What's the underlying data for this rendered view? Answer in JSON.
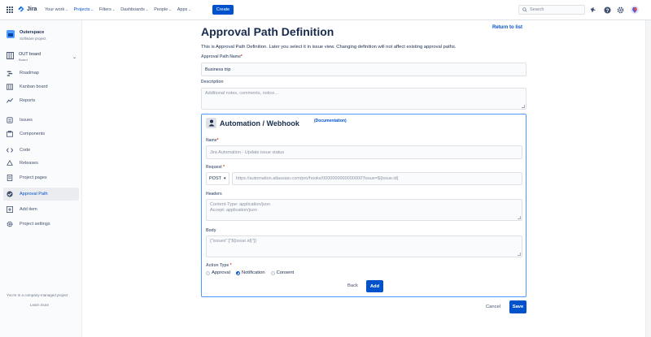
{
  "topnav": {
    "logo": "Jira",
    "menu": [
      {
        "label": "Your work",
        "active": false
      },
      {
        "label": "Projects",
        "active": true
      },
      {
        "label": "Filters",
        "active": false
      },
      {
        "label": "Dashboards",
        "active": false
      },
      {
        "label": "People",
        "active": false
      },
      {
        "label": "Apps",
        "active": false
      }
    ],
    "create_label": "Create",
    "search_placeholder": "Search"
  },
  "sidebar": {
    "project_name": "Outerspace",
    "project_type": "Software project",
    "board_name": "OUT board",
    "board_type": "Board",
    "items": [
      {
        "label": "Roadmap",
        "icon": "roadmap-icon"
      },
      {
        "label": "Kanban board",
        "icon": "board-icon"
      },
      {
        "label": "Reports",
        "icon": "reports-icon"
      },
      {
        "label": "Issues",
        "icon": "issues-icon"
      },
      {
        "label": "Components",
        "icon": "components-icon"
      },
      {
        "label": "Code",
        "icon": "code-icon"
      },
      {
        "label": "Releases",
        "icon": "releases-icon"
      },
      {
        "label": "Project pages",
        "icon": "pages-icon"
      },
      {
        "label": "Approval Path",
        "icon": "approval-icon",
        "active": true
      },
      {
        "label": "Add item",
        "icon": "add-icon"
      },
      {
        "label": "Project settings",
        "icon": "settings-icon"
      }
    ],
    "footer_note": "You're in a company-managed project",
    "footer_link": "Learn more"
  },
  "main": {
    "title": "Approval Path Definition",
    "return_link": "Return to list",
    "intro": "This is Approval Path Definition. Later you select it in issue view. Changing definition will not affect existing approval paths.",
    "path_name_label": "Approval Path Name",
    "path_name_value": "Business trip",
    "description_label": "Description",
    "description_placeholder": "Additional notes, comments, notice..."
  },
  "webhook": {
    "title": "Automation / Webhook",
    "doc_link": "(Documentation)",
    "name_label": "Name",
    "name_placeholder": "Jira Automation - Update issue status",
    "request_label": "Request",
    "method": "POST",
    "url_placeholder": "https://automation.atlassian.com/pro/hooks/0000000000000000?issue=${issue.id}",
    "headers_label": "Headers",
    "headers_line1": "Content-Type: application/json",
    "headers_line2": "Accept: application/json",
    "body_label": "Body",
    "body_placeholder": "{\"issues\":[\"${issue.id}\"]}",
    "action_type_label": "Action Type",
    "action_types": [
      {
        "label": "Approval",
        "checked": false
      },
      {
        "label": "Notification",
        "checked": true
      },
      {
        "label": "Consent",
        "checked": false
      }
    ],
    "back_label": "Back",
    "add_label": "Add"
  },
  "footer": {
    "cancel_label": "Cancel",
    "save_label": "Save"
  },
  "colors": {
    "accent": "#0052cc",
    "required": "#de350b",
    "box_border": "#4c9aff"
  }
}
